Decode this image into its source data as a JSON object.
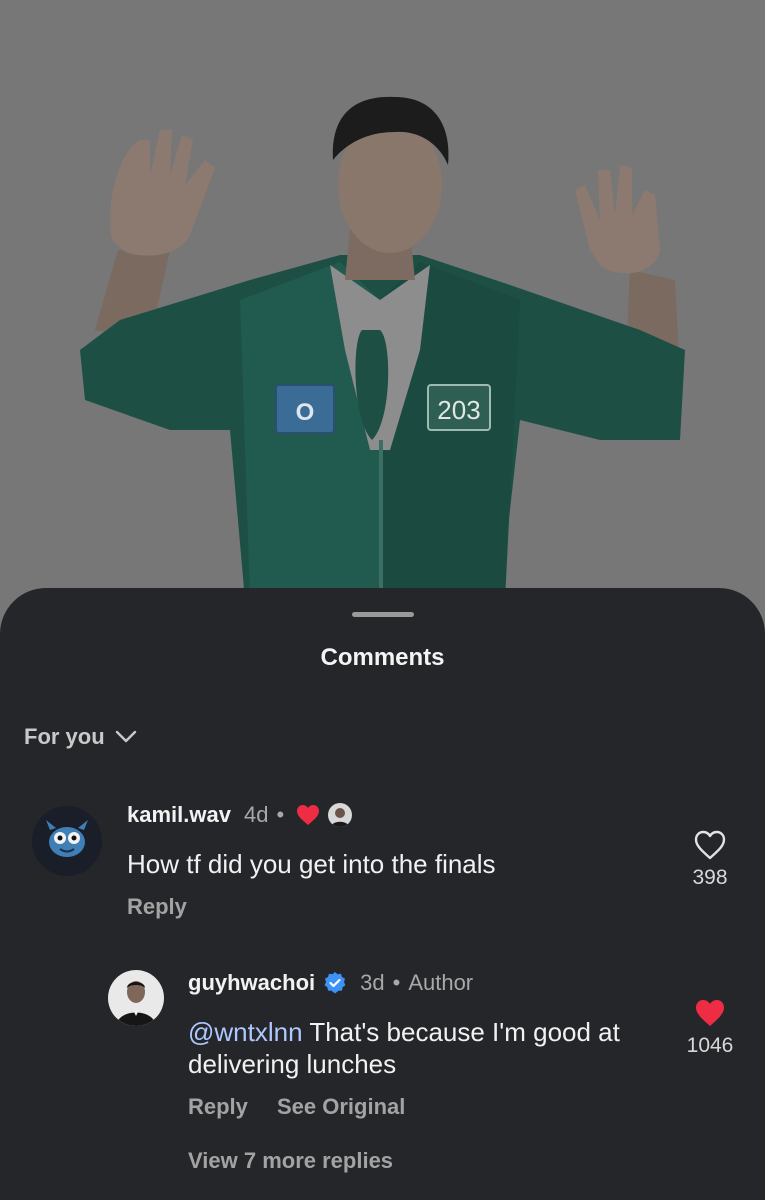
{
  "photo": {
    "badge_left": "O",
    "badge_right": "203"
  },
  "sheet": {
    "title": "Comments",
    "filter_label": "For you",
    "filter_icon": "chevron-down-icon"
  },
  "comments": [
    {
      "username": "kamil.wav",
      "time": "4d",
      "dot": "•",
      "text": "How tf did you get into the finals",
      "reply_label": "Reply",
      "like_count": "398",
      "liked_by_author": true
    },
    {
      "username": "guyhwachoi",
      "verified": true,
      "time": "3d",
      "dot": "•",
      "author_label": "Author",
      "mention": "@wntxlnn",
      "text": " That's because I'm good at delivering lunches",
      "reply_label": "Reply",
      "see_original_label": "See Original",
      "like_count": "1046",
      "liked": true
    }
  ],
  "view_more_label": "View 7 more replies",
  "colors": {
    "sheet_bg": "#25262a",
    "heart_red": "#ee2d45",
    "verified_blue": "#3e92f5",
    "mention_blue": "#aec8ff",
    "jacket_green": "#1e5a4c"
  }
}
